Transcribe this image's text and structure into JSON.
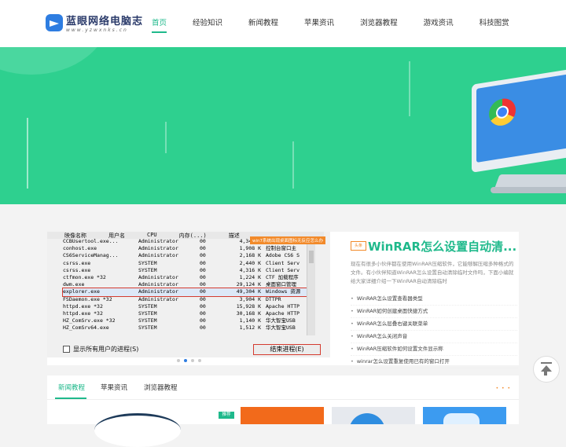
{
  "logo": {
    "name": "蓝眼网络电脑志",
    "url": "www.yzwxnks.cn"
  },
  "nav": [
    {
      "label": "首页",
      "active": true
    },
    {
      "label": "经验知识"
    },
    {
      "label": "新闻教程"
    },
    {
      "label": "苹果资讯"
    },
    {
      "label": "浏览器教程"
    },
    {
      "label": "游戏资讯"
    },
    {
      "label": "科技图赏"
    }
  ],
  "colors": {
    "accent": "#1fb98b",
    "banner": "#2ed08f",
    "tag": "#f28a2a"
  },
  "featured": {
    "overlay_tag": "win7系统出现桌面图标无反应怎么办",
    "task_manager": {
      "headers": [
        "映像名称",
        "用户名",
        "CPU",
        "内存(...)",
        "描述"
      ],
      "rows": [
        [
          "CCBUsertool.exe...",
          "Administrator",
          "00",
          "4,340 K",
          ""
        ],
        [
          "conhost.exe",
          "Administrator",
          "00",
          "1,908 K",
          "控制台窗口主"
        ],
        [
          "CS6ServiceManag...",
          "Administrator",
          "00",
          "2,168 K",
          "Adobe CS6 S"
        ],
        [
          "csrss.exe",
          "SYSTEM",
          "00",
          "2,440 K",
          "Client Serv"
        ],
        [
          "csrss.exe",
          "SYSTEM",
          "00",
          "4,316 K",
          "Client Serv"
        ],
        [
          "ctfmon.exe *32",
          "Administrator",
          "00",
          "1,224 K",
          "CTF 加载程序"
        ],
        [
          "dwm.exe",
          "Administrator",
          "00",
          "29,124 K",
          "桌面窗口管理"
        ],
        [
          "explorer.exe",
          "Administrator",
          "00",
          "49,304 K",
          "Windows 资源"
        ],
        [
          "FSDaemon.exe *32",
          "Administrator",
          "00",
          "3,904 K",
          "DTTPR"
        ],
        [
          "httpd.exe *32",
          "SYSTEM",
          "00",
          "15,928 K",
          "Apache HTTP"
        ],
        [
          "httpd.exe *32",
          "SYSTEM",
          "00",
          "30,168 K",
          "Apache HTTP"
        ],
        [
          "HZ_ComSrv.exe *32",
          "SYSTEM",
          "00",
          "1,140 K",
          "华大智宝USB"
        ],
        [
          "HZ_ComSrv64.exe",
          "SYSTEM",
          "00",
          "1,512 K",
          "华大智宝USB"
        ]
      ],
      "highlight_row": "explorer.exe",
      "show_all_label": "显示所有用户的进程(S)",
      "end_process_label": "结束进程(E)"
    },
    "tag": "头条",
    "title": "WinRAR怎么设置自动清...",
    "description": "现在有很多小伙伴都在使用WinRAR压缩软件，它能够解压缩多种格式的文件。有小伙伴知道WinRAR怎么设置自动清除临时文件吗，下面小编就给大家详细介绍一下WinRAR自动清除临时",
    "list": [
      "WinRAR怎么设置查看器类型",
      "WinRAR如何创建桌面快捷方式",
      "WinRAR怎么层叠右键关联菜单",
      "WinRAR怎么关闭声音",
      "WinRAR压缩软件如何设置文件显示称",
      "winrar怎么设置重复使用已有的窗口打开"
    ]
  },
  "tabs": [
    {
      "label": "新闻教程",
      "active": true
    },
    {
      "label": "苹果资讯"
    },
    {
      "label": "浏览器教程"
    }
  ],
  "card_tag": "推荐",
  "more_dots": "• • •"
}
